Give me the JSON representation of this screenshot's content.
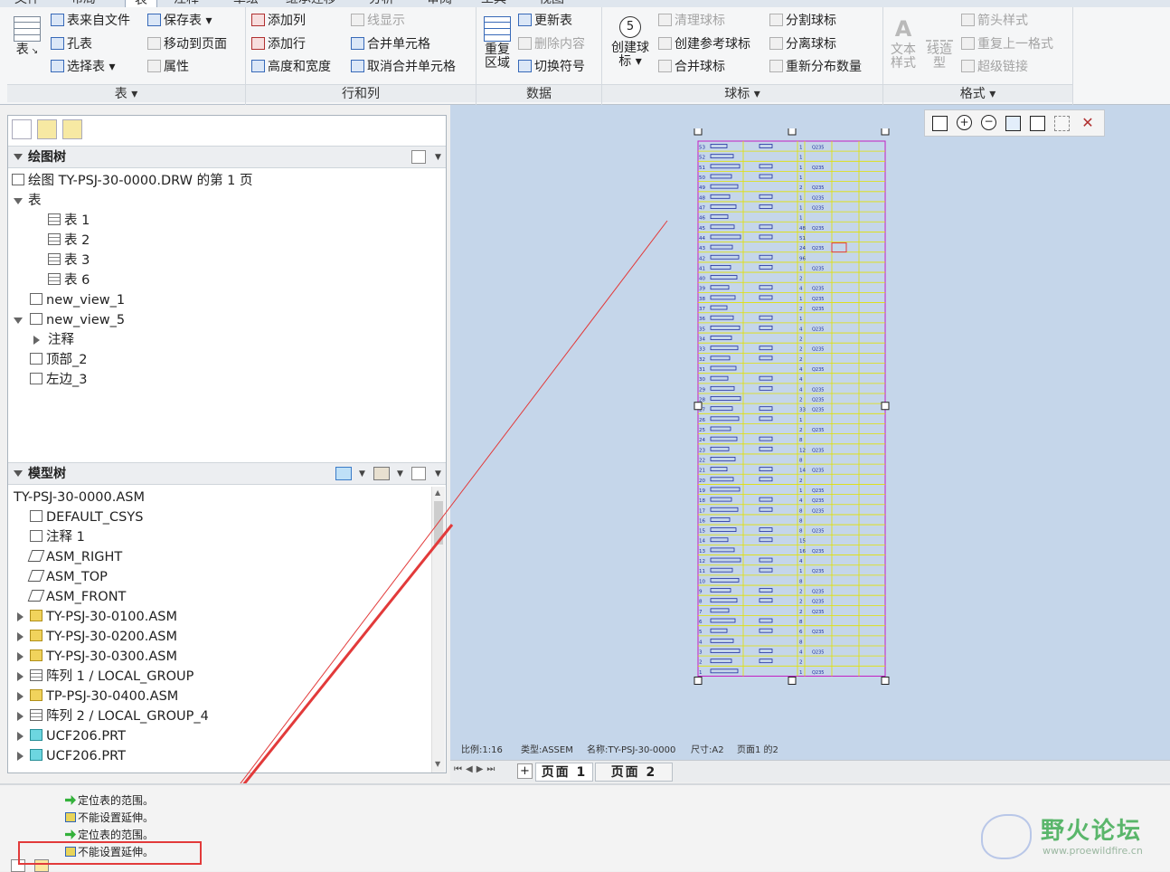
{
  "menu_tabs": [
    "文件",
    "布局",
    "表",
    "注释",
    "草绘",
    "继承迁移",
    "分析",
    "审阅",
    "工具",
    "视图"
  ],
  "active_tab": "表",
  "ribbon": {
    "groups": [
      {
        "label": "表 ▾"
      },
      {
        "label": "行和列"
      },
      {
        "label": "数据"
      },
      {
        "label": "球标 ▾"
      },
      {
        "label": "格式 ▾"
      }
    ],
    "table_group": {
      "big_button": "表",
      "b1": "表来自文件",
      "b2": "保存表 ▾",
      "b3": "孔表",
      "b4": "移动到页面",
      "b5": "选择表 ▾",
      "b6": "属性"
    },
    "rowcol_group": {
      "b1": "添加列",
      "b2": "线显示",
      "b3": "添加行",
      "b4": "合并单元格",
      "b5": "高度和宽度",
      "b6": "取消合并单元格"
    },
    "data_group": {
      "big_button": "重复区域",
      "b1": "更新表",
      "b2": "删除内容",
      "b3": "切换符号"
    },
    "balloon_group": {
      "big_button": "创建球标 ▾",
      "balloon_number": "5",
      "b1": "清理球标",
      "b2": "分割球标",
      "b3": "创建参考球标",
      "b4": "分离球标",
      "b5": "合并球标",
      "b6": "重新分布数量"
    },
    "format_group": {
      "big1": "文本样式",
      "big2": "线造型",
      "b1": "箭头样式",
      "b2": "重复上一格式",
      "b3": "超级链接"
    }
  },
  "drawing_tree": {
    "title": "绘图树",
    "root": "绘图 TY-PSJ-30-0000.DRW 的第 1 页",
    "items": [
      {
        "label": "表",
        "level": 1,
        "icon": "none",
        "state": "open"
      },
      {
        "label": "表 1",
        "level": 2,
        "icon": "table-icon",
        "state": "none"
      },
      {
        "label": "表 2",
        "level": 2,
        "icon": "table-icon",
        "state": "none"
      },
      {
        "label": "表 3",
        "level": 2,
        "icon": "table-icon",
        "state": "none"
      },
      {
        "label": "表 6",
        "level": 2,
        "icon": "table-icon",
        "state": "none"
      },
      {
        "label": "new_view_1",
        "level": 1,
        "icon": "view-icon",
        "state": "none"
      },
      {
        "label": "new_view_5",
        "level": 1,
        "icon": "view-icon",
        "state": "open"
      },
      {
        "label": "注释",
        "level": 2,
        "icon": "none",
        "state": "closed"
      },
      {
        "label": "顶部_2",
        "level": 1,
        "icon": "view-icon",
        "state": "none"
      },
      {
        "label": "左边_3",
        "level": 1,
        "icon": "view-icon",
        "state": "none"
      }
    ]
  },
  "model_tree": {
    "title": "模型树",
    "root": "TY-PSJ-30-0000.ASM",
    "items": [
      {
        "label": "DEFAULT_CSYS",
        "icon": "csys-icon",
        "state": "none"
      },
      {
        "label": "注释 1",
        "icon": "note-icon",
        "state": "none"
      },
      {
        "label": "ASM_RIGHT",
        "icon": "datum-plane-icon",
        "state": "none"
      },
      {
        "label": "ASM_TOP",
        "icon": "datum-plane-icon",
        "state": "none"
      },
      {
        "label": "ASM_FRONT",
        "icon": "datum-plane-icon",
        "state": "none"
      },
      {
        "label": "TY-PSJ-30-0100.ASM",
        "icon": "assembly-icon",
        "state": "closed"
      },
      {
        "label": "TY-PSJ-30-0200.ASM",
        "icon": "assembly-icon",
        "state": "closed"
      },
      {
        "label": "TY-PSJ-30-0300.ASM",
        "icon": "assembly-icon",
        "state": "closed"
      },
      {
        "label": "阵列 1 / LOCAL_GROUP",
        "icon": "pattern-icon",
        "state": "closed"
      },
      {
        "label": "TP-PSJ-30-0400.ASM",
        "icon": "assembly-icon",
        "state": "closed"
      },
      {
        "label": "阵列 2 / LOCAL_GROUP_4",
        "icon": "pattern-icon",
        "state": "closed"
      },
      {
        "label": "UCF206.PRT",
        "icon": "part-icon",
        "state": "closed"
      },
      {
        "label": "UCF206.PRT",
        "icon": "part-icon",
        "state": "closed"
      }
    ]
  },
  "drawing_status": {
    "scale": "比例:1:16",
    "type": "类型:ASSEM",
    "name": "名称:TY-PSJ-30-0000",
    "size": "尺寸:A2",
    "page": "页面1 的2"
  },
  "page_tabs": [
    "页面 1",
    "页面 2"
  ],
  "messages": [
    {
      "text": "定位表的范围。",
      "type": "ok"
    },
    {
      "text": "不能设置延伸。",
      "type": "warn"
    },
    {
      "text": "定位表的范围。",
      "type": "ok"
    },
    {
      "text": "不能设置延伸。",
      "type": "warn"
    }
  ],
  "table_rows": [
    "53",
    "52",
    "51",
    "50",
    "49",
    "48",
    "47",
    "46",
    "45",
    "44",
    "43",
    "42",
    "41",
    "40",
    "39",
    "38",
    "37",
    "36",
    "35",
    "34",
    "33",
    "32",
    "31",
    "30",
    "29",
    "28",
    "27",
    "26",
    "25",
    "24",
    "23",
    "22",
    "21",
    "20",
    "19",
    "18",
    "17",
    "16",
    "15",
    "14",
    "13",
    "12",
    "11",
    "10",
    "9",
    "8",
    "7",
    "6",
    "5",
    "4",
    "3",
    "2",
    "1"
  ],
  "table_qty": [
    "1",
    "1",
    "1",
    "1",
    "2",
    "1",
    "1",
    "1",
    "48",
    "51",
    "24",
    "96",
    "1",
    "2",
    "4",
    "1",
    "2",
    "1",
    "4",
    "2",
    "2",
    "2",
    "4",
    "4",
    "4",
    "2",
    "33",
    "1",
    "2",
    "8",
    "12",
    "8",
    "14",
    "2",
    "1",
    "4",
    "8",
    "8",
    "8",
    "15",
    "16",
    "4",
    "1",
    "8",
    "2",
    "2",
    "2",
    "8",
    "6",
    "8",
    "4",
    "2",
    "1"
  ],
  "colors": {
    "canvas": "#c5d6ea",
    "table_grid": "#e2e200",
    "table_frame": "#c21ec2",
    "annotation_arrow": "#e23a3a"
  },
  "watermark": {
    "title": "野火论坛",
    "url": "www.proewildfire.cn"
  }
}
